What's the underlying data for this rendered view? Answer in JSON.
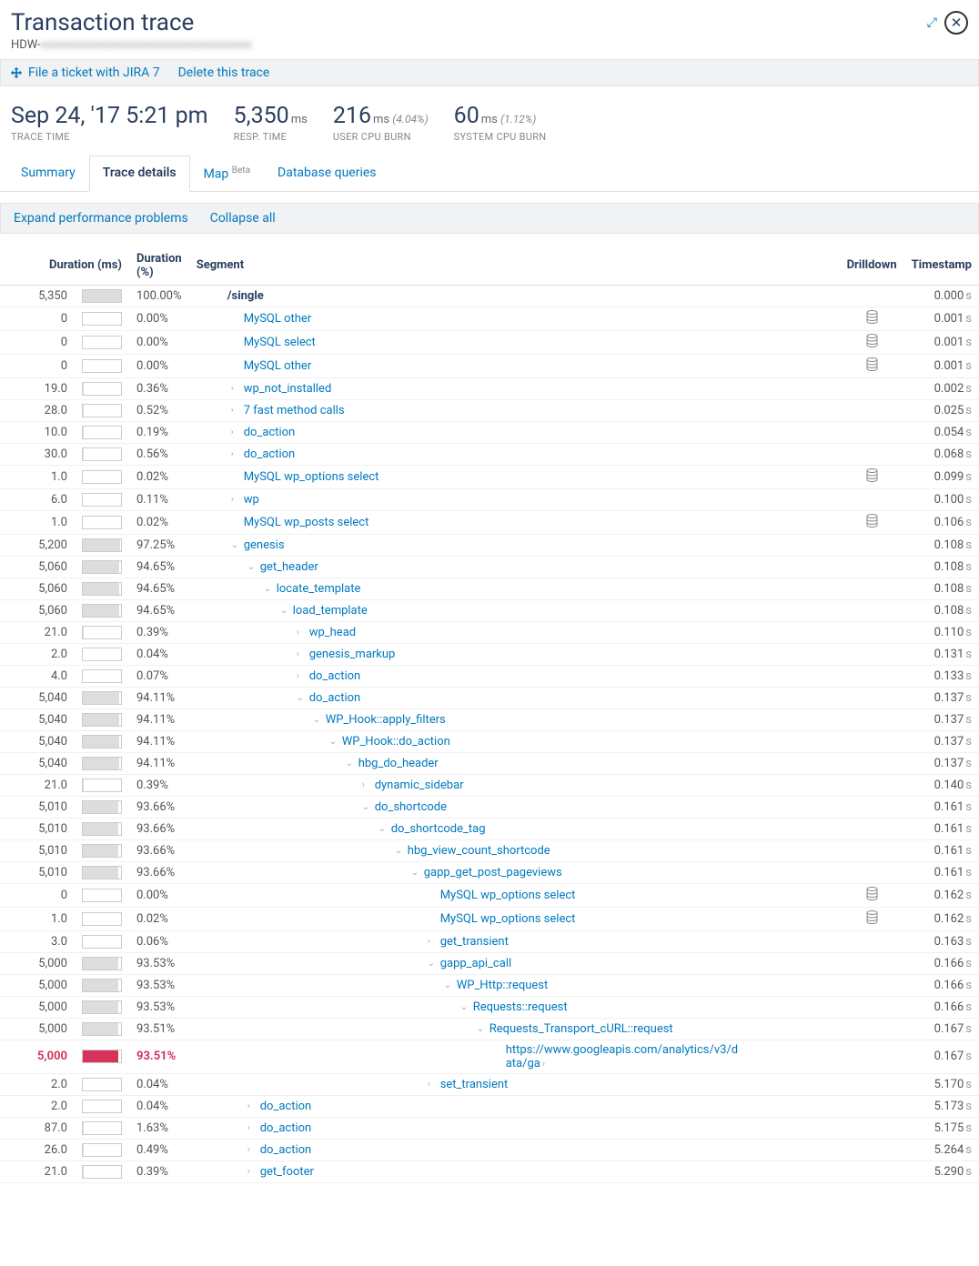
{
  "header": {
    "title": "Transaction trace",
    "subtitle_prefix": "HDW-",
    "subtitle_blur": "xxxxxxxxxxxxxxxxxxxxxxxxxxxxxxxxxxxx"
  },
  "actions": {
    "file_ticket": "File a ticket with JIRA 7",
    "delete_trace": "Delete this trace"
  },
  "metrics": {
    "trace_time": {
      "value": "Sep 24, '17 5:21 pm",
      "label": "TRACE TIME"
    },
    "resp_time": {
      "value": "5,350",
      "unit": "ms",
      "label": "RESP. TIME"
    },
    "user_cpu": {
      "value": "216",
      "unit": "ms",
      "pct": "(4.04%)",
      "label": "USER CPU BURN"
    },
    "sys_cpu": {
      "value": "60",
      "unit": "ms",
      "pct": "(1.12%)",
      "label": "SYSTEM CPU BURN"
    }
  },
  "tabs": {
    "summary": "Summary",
    "details": "Trace details",
    "map": "Map",
    "map_badge": "Beta",
    "db": "Database queries"
  },
  "toolbar": {
    "expand": "Expand performance problems",
    "collapse": "Collapse all"
  },
  "columns": {
    "dur_ms": "Duration (ms)",
    "dur_pct": "Duration (%)",
    "segment": "Segment",
    "drilldown": "Drilldown",
    "timestamp": "Timestamp"
  },
  "rows": [
    {
      "ms": "5,350",
      "bar": 100,
      "pct": "100.00%",
      "seg": "/single",
      "indent": 0,
      "arrow": "",
      "drill": "",
      "ts": "0.000",
      "bold": true
    },
    {
      "ms": "0",
      "bar": 0,
      "pct": "0.00%",
      "seg": "MySQL other",
      "indent": 1,
      "arrow": "",
      "drill": "db",
      "ts": "0.001"
    },
    {
      "ms": "0",
      "bar": 0,
      "pct": "0.00%",
      "seg": "MySQL select",
      "indent": 1,
      "arrow": "",
      "drill": "db",
      "ts": "0.001"
    },
    {
      "ms": "0",
      "bar": 0,
      "pct": "0.00%",
      "seg": "MySQL other",
      "indent": 1,
      "arrow": "",
      "drill": "db",
      "ts": "0.001"
    },
    {
      "ms": "19.0",
      "bar": 0.36,
      "pct": "0.36%",
      "seg": "wp_not_installed",
      "indent": 1,
      "arrow": ">",
      "drill": "",
      "ts": "0.002"
    },
    {
      "ms": "28.0",
      "bar": 0.52,
      "pct": "0.52%",
      "seg": "7 fast method calls",
      "indent": 1,
      "arrow": ">",
      "drill": "",
      "ts": "0.025"
    },
    {
      "ms": "10.0",
      "bar": 0.19,
      "pct": "0.19%",
      "seg": "do_action",
      "indent": 1,
      "arrow": ">",
      "drill": "",
      "ts": "0.054"
    },
    {
      "ms": "30.0",
      "bar": 0.56,
      "pct": "0.56%",
      "seg": "do_action",
      "indent": 1,
      "arrow": ">",
      "drill": "",
      "ts": "0.068"
    },
    {
      "ms": "1.0",
      "bar": 0.02,
      "pct": "0.02%",
      "seg": "MySQL wp_options select",
      "indent": 1,
      "arrow": "",
      "drill": "db",
      "ts": "0.099"
    },
    {
      "ms": "6.0",
      "bar": 0.11,
      "pct": "0.11%",
      "seg": "wp",
      "indent": 1,
      "arrow": ">",
      "drill": "",
      "ts": "0.100"
    },
    {
      "ms": "1.0",
      "bar": 0.02,
      "pct": "0.02%",
      "seg": "MySQL wp_posts select",
      "indent": 1,
      "arrow": "",
      "drill": "db",
      "ts": "0.106"
    },
    {
      "ms": "5,200",
      "bar": 97.25,
      "pct": "97.25%",
      "seg": "genesis",
      "indent": 1,
      "arrow": "v",
      "drill": "",
      "ts": "0.108"
    },
    {
      "ms": "5,060",
      "bar": 94.65,
      "pct": "94.65%",
      "seg": "get_header",
      "indent": 2,
      "arrow": "v",
      "drill": "",
      "ts": "0.108"
    },
    {
      "ms": "5,060",
      "bar": 94.65,
      "pct": "94.65%",
      "seg": "locate_template",
      "indent": 3,
      "arrow": "v",
      "drill": "",
      "ts": "0.108"
    },
    {
      "ms": "5,060",
      "bar": 94.65,
      "pct": "94.65%",
      "seg": "load_template",
      "indent": 4,
      "arrow": "v",
      "drill": "",
      "ts": "0.108"
    },
    {
      "ms": "21.0",
      "bar": 0.39,
      "pct": "0.39%",
      "seg": "wp_head",
      "indent": 5,
      "arrow": ">",
      "drill": "",
      "ts": "0.110"
    },
    {
      "ms": "2.0",
      "bar": 0.04,
      "pct": "0.04%",
      "seg": "genesis_markup",
      "indent": 5,
      "arrow": ">",
      "drill": "",
      "ts": "0.131"
    },
    {
      "ms": "4.0",
      "bar": 0.07,
      "pct": "0.07%",
      "seg": "do_action",
      "indent": 5,
      "arrow": ">",
      "drill": "",
      "ts": "0.133"
    },
    {
      "ms": "5,040",
      "bar": 94.11,
      "pct": "94.11%",
      "seg": "do_action",
      "indent": 5,
      "arrow": "v",
      "drill": "",
      "ts": "0.137"
    },
    {
      "ms": "5,040",
      "bar": 94.11,
      "pct": "94.11%",
      "seg": "WP_Hook::apply_filters",
      "indent": 6,
      "arrow": "v",
      "drill": "",
      "ts": "0.137"
    },
    {
      "ms": "5,040",
      "bar": 94.11,
      "pct": "94.11%",
      "seg": "WP_Hook::do_action",
      "indent": 7,
      "arrow": "v",
      "drill": "",
      "ts": "0.137"
    },
    {
      "ms": "5,040",
      "bar": 94.11,
      "pct": "94.11%",
      "seg": "hbg_do_header",
      "indent": 8,
      "arrow": "v",
      "drill": "",
      "ts": "0.137"
    },
    {
      "ms": "21.0",
      "bar": 0.39,
      "pct": "0.39%",
      "seg": "dynamic_sidebar",
      "indent": 9,
      "arrow": ">",
      "drill": "",
      "ts": "0.140"
    },
    {
      "ms": "5,010",
      "bar": 93.66,
      "pct": "93.66%",
      "seg": "do_shortcode",
      "indent": 9,
      "arrow": "v",
      "drill": "",
      "ts": "0.161"
    },
    {
      "ms": "5,010",
      "bar": 93.66,
      "pct": "93.66%",
      "seg": "do_shortcode_tag",
      "indent": 10,
      "arrow": "v",
      "drill": "",
      "ts": "0.161"
    },
    {
      "ms": "5,010",
      "bar": 93.66,
      "pct": "93.66%",
      "seg": "hbg_view_count_shortcode",
      "indent": 11,
      "arrow": "v",
      "drill": "",
      "ts": "0.161"
    },
    {
      "ms": "5,010",
      "bar": 93.66,
      "pct": "93.66%",
      "seg": "gapp_get_post_pageviews",
      "indent": 12,
      "arrow": "v",
      "drill": "",
      "ts": "0.161"
    },
    {
      "ms": "0",
      "bar": 0,
      "pct": "0.00%",
      "seg": "MySQL wp_options select",
      "indent": 13,
      "arrow": "",
      "drill": "db",
      "ts": "0.162"
    },
    {
      "ms": "1.0",
      "bar": 0.02,
      "pct": "0.02%",
      "seg": "MySQL wp_options select",
      "indent": 13,
      "arrow": "",
      "drill": "db",
      "ts": "0.162"
    },
    {
      "ms": "3.0",
      "bar": 0.06,
      "pct": "0.06%",
      "seg": "get_transient",
      "indent": 13,
      "arrow": ">",
      "drill": "",
      "ts": "0.163"
    },
    {
      "ms": "5,000",
      "bar": 93.53,
      "pct": "93.53%",
      "seg": "gapp_api_call",
      "indent": 13,
      "arrow": "v",
      "drill": "",
      "ts": "0.166"
    },
    {
      "ms": "5,000",
      "bar": 93.53,
      "pct": "93.53%",
      "seg": "WP_Http::request",
      "indent": 14,
      "arrow": "v",
      "drill": "",
      "ts": "0.166"
    },
    {
      "ms": "5,000",
      "bar": 93.53,
      "pct": "93.53%",
      "seg": "Requests::request",
      "indent": 15,
      "arrow": "v",
      "drill": "",
      "ts": "0.166"
    },
    {
      "ms": "5,000",
      "bar": 93.51,
      "pct": "93.51%",
      "seg": "Requests_Transport_cURL::request",
      "indent": 16,
      "arrow": "v",
      "drill": "",
      "ts": "0.167"
    },
    {
      "ms": "5,000",
      "bar": 93.51,
      "pct": "93.51%",
      "seg": "https://www.googleapis.com/analytics/v3/data/ga",
      "indent": 17,
      "arrow": "",
      "drill": "",
      "ts": "0.167",
      "red": true,
      "ext": true
    },
    {
      "ms": "2.0",
      "bar": 0.04,
      "pct": "0.04%",
      "seg": "set_transient",
      "indent": 13,
      "arrow": ">",
      "drill": "",
      "ts": "5.170"
    },
    {
      "ms": "2.0",
      "bar": 0.04,
      "pct": "0.04%",
      "seg": "do_action",
      "indent": 2,
      "arrow": ">",
      "drill": "",
      "ts": "5.173"
    },
    {
      "ms": "87.0",
      "bar": 1.63,
      "pct": "1.63%",
      "seg": "do_action",
      "indent": 2,
      "arrow": ">",
      "drill": "",
      "ts": "5.175"
    },
    {
      "ms": "26.0",
      "bar": 0.49,
      "pct": "0.49%",
      "seg": "do_action",
      "indent": 2,
      "arrow": ">",
      "drill": "",
      "ts": "5.264"
    },
    {
      "ms": "21.0",
      "bar": 0.39,
      "pct": "0.39%",
      "seg": "get_footer",
      "indent": 2,
      "arrow": ">",
      "drill": "",
      "ts": "5.290"
    }
  ]
}
